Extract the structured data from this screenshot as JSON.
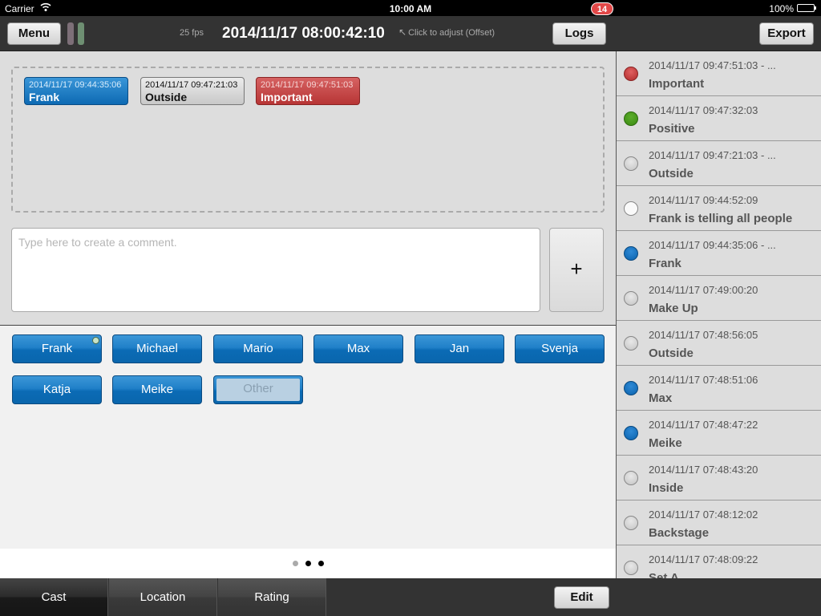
{
  "status_bar": {
    "carrier": "Carrier",
    "time": "10:00 AM",
    "battery": "100%"
  },
  "toolbar": {
    "menu_label": "Menu",
    "fps": "25 fps",
    "timecode": "2014/11/17 08:00:42:10",
    "adjust_hint": "Click to adjust (Offset)",
    "adjust_arrow": "↖",
    "logs_label": "Logs",
    "logs_badge": "14",
    "export_label": "Export"
  },
  "timeline_chips": [
    {
      "time": "2014/11/17 09:44:35:06",
      "label": "Frank",
      "color": "#1a7cc4"
    },
    {
      "time": "2014/11/17 09:47:21:03",
      "label": "Outside",
      "color": "#d8d8d8"
    },
    {
      "time": "2014/11/17 09:47:51:03",
      "label": "Important",
      "color": "#c74848"
    }
  ],
  "comment": {
    "value": "",
    "placeholder": "Type here to create a comment.",
    "add_label": "+"
  },
  "cast": [
    {
      "label": "Frank",
      "active": true
    },
    {
      "label": "Michael"
    },
    {
      "label": "Mario"
    },
    {
      "label": "Max"
    },
    {
      "label": "Jan"
    },
    {
      "label": "Svenja"
    },
    {
      "label": "Katja"
    },
    {
      "label": "Meike"
    },
    {
      "label": "Other",
      "disabled": true
    }
  ],
  "pager": {
    "pages": 3,
    "current": 1
  },
  "tabs": [
    {
      "label": "Cast",
      "selected": true
    },
    {
      "label": "Location"
    },
    {
      "label": "Rating"
    }
  ],
  "edit_label": "Edit",
  "logs": [
    {
      "time": "2014/11/17 09:47:51:03 - ...",
      "label": "Important",
      "dot": "red"
    },
    {
      "time": "2014/11/17 09:47:32:03",
      "label": "Positive",
      "dot": "green"
    },
    {
      "time": "2014/11/17 09:47:21:03 - ...",
      "label": "Outside",
      "dot": "grey"
    },
    {
      "time": "2014/11/17 09:44:52:09",
      "label": "Frank is telling all people",
      "dot": "white"
    },
    {
      "time": "2014/11/17 09:44:35:06 - ...",
      "label": "Frank",
      "dot": "blue"
    },
    {
      "time": "2014/11/17 07:49:00:20",
      "label": "Make Up",
      "dot": "grey"
    },
    {
      "time": "2014/11/17 07:48:56:05",
      "label": "Outside",
      "dot": "grey"
    },
    {
      "time": "2014/11/17 07:48:51:06",
      "label": "Max",
      "dot": "blue"
    },
    {
      "time": "2014/11/17 07:48:47:22",
      "label": "Meike",
      "dot": "blue"
    },
    {
      "time": "2014/11/17 07:48:43:20",
      "label": "Inside",
      "dot": "grey"
    },
    {
      "time": "2014/11/17 07:48:12:02",
      "label": "Backstage",
      "dot": "grey"
    },
    {
      "time": "2014/11/17 07:48:09:22",
      "label": "Set A",
      "dot": "grey"
    }
  ]
}
